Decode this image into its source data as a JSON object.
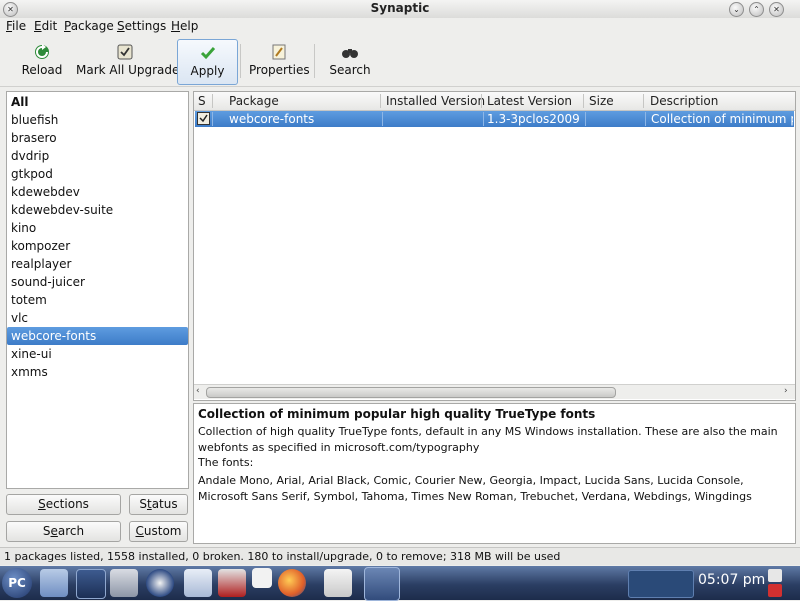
{
  "window": {
    "title": "Synaptic"
  },
  "menubar": [
    {
      "label": "File",
      "mnemonic": "F",
      "rest": "ile"
    },
    {
      "label": "Edit",
      "mnemonic": "E",
      "rest": "dit"
    },
    {
      "label": "Package",
      "mnemonic": "P",
      "rest": "ackage"
    },
    {
      "label": "Settings",
      "mnemonic": "S",
      "rest": "ettings"
    },
    {
      "label": "Help",
      "mnemonic": "H",
      "rest": "elp"
    }
  ],
  "toolbar": {
    "reload": "Reload",
    "mark_all_upgrades": "Mark All Upgrades",
    "apply": "Apply",
    "properties": "Properties",
    "search": "Search"
  },
  "sections": {
    "items": [
      "All",
      "bluefish",
      "brasero",
      "dvdrip",
      "gtkpod",
      "kdewebdev",
      "kdewebdev-suite",
      "kino",
      "kompozer",
      "realplayer",
      "sound-juicer",
      "totem",
      "vlc",
      "webcore-fonts",
      "xine-ui",
      "xmms"
    ],
    "selected": "webcore-fonts"
  },
  "filter_buttons": {
    "sections": {
      "mnemonic": "S",
      "rest": "ections"
    },
    "status": {
      "mnemonic": "t",
      "pre": "S",
      "rest": "atus"
    },
    "search": {
      "pre": "S",
      "mnemonic": "e",
      "rest": "arch"
    },
    "custom": {
      "mnemonic": "C",
      "rest": "ustom"
    }
  },
  "table": {
    "columns": {
      "s": "S",
      "package": "Package",
      "installed_version": "Installed Version",
      "latest_version": "Latest Version",
      "size": "Size",
      "description": "Description"
    },
    "rows": [
      {
        "package": "webcore-fonts",
        "installed_version": "",
        "latest_version": "1.3-3pclos2009",
        "size": "",
        "description": "Collection of minimum popu"
      }
    ]
  },
  "description": {
    "title": "Collection of minimum popular high quality TrueType fonts",
    "para1": "Collection of high quality TrueType fonts, default in any MS Windows installation. These are also the main webfonts as specified in microsoft.com/typography",
    "para2": "The fonts:",
    "para3": "Andale Mono, Arial, Arial Black, Comic, Courier New, Georgia, Impact, Lucida Sans, Lucida Console, Microsoft Sans Serif, Symbol, Tahoma, Times New Roman, Trebuchet, Verdana, Webdings, Wingdings"
  },
  "status": {
    "text": "1 packages listed, 1558 installed, 0 broken. 180 to install/upgrade, 0 to remove; 318 MB will be used"
  },
  "taskbar": {
    "clock": "05:07 pm"
  },
  "colors": {
    "selection": "#3d7cc8",
    "taskbar": "#2b3e63"
  }
}
